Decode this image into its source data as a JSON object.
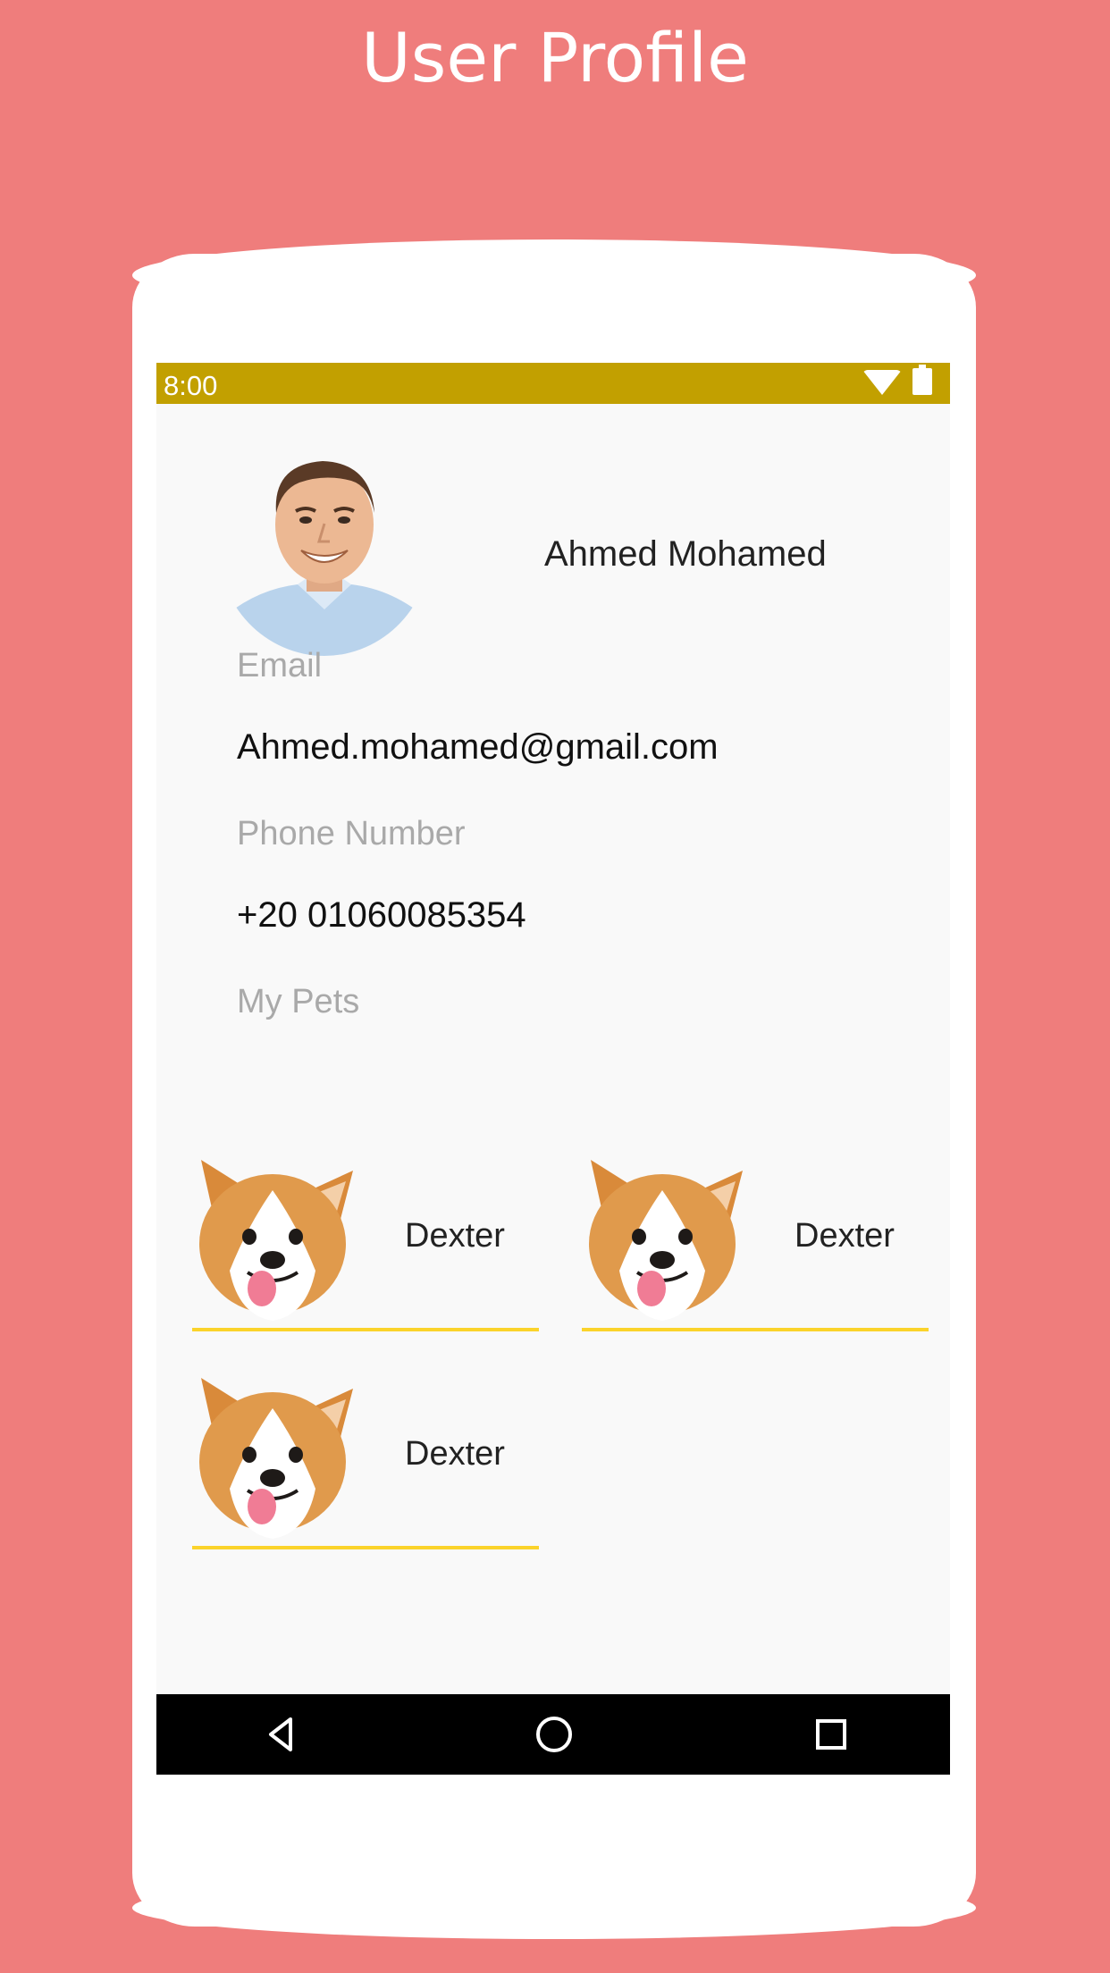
{
  "header": {
    "title": "User Profile"
  },
  "status_bar": {
    "time": "8:00",
    "icons": [
      "wifi-icon",
      "battery-icon"
    ],
    "color": "#c2a000"
  },
  "profile": {
    "name": "Ahmed Mohamed",
    "email_label": "Email",
    "email": "Ahmed.mohamed@gmail.com",
    "phone_label": "Phone Number",
    "phone": "+20 01060085354",
    "pets_label": "My Pets"
  },
  "pets": [
    {
      "name": "Dexter"
    },
    {
      "name": "Dexter"
    },
    {
      "name": "Dexter"
    }
  ],
  "nav_bar": {
    "buttons": [
      "back-icon",
      "home-icon",
      "recents-icon"
    ]
  },
  "colors": {
    "background": "#ef7d7c",
    "accent_underline": "#fbd32b"
  }
}
